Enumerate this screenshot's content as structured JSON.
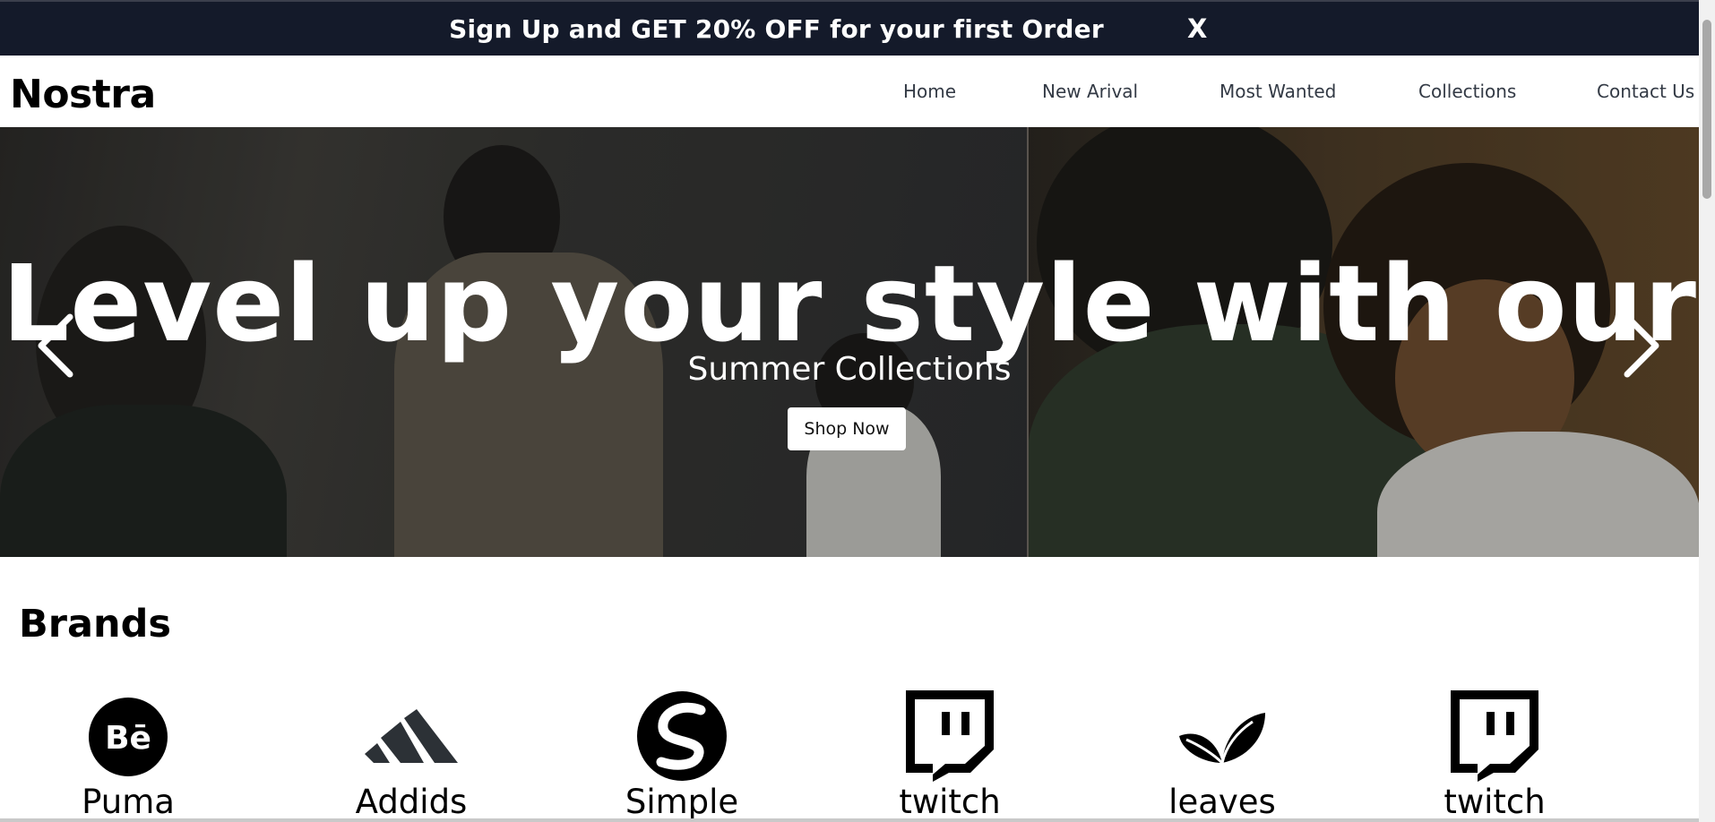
{
  "promo": {
    "text": "Sign Up and GET 20% OFF for your first Order",
    "close_label": "X"
  },
  "header": {
    "logo": "Nostra",
    "nav": [
      "Home",
      "New Arival",
      "Most Wanted",
      "Collections",
      "Contact Us"
    ]
  },
  "hero": {
    "title": "Level up your style with our",
    "subtitle": "Summer Collections",
    "button_label": "Shop Now",
    "prev_icon": "chevron-left-icon",
    "next_icon": "chevron-right-icon"
  },
  "brands": {
    "title": "Brands",
    "items": [
      {
        "label": "Puma",
        "icon": "behance-icon"
      },
      {
        "label": "Addids",
        "icon": "adidas-icon"
      },
      {
        "label": "Simple",
        "icon": "squarespace-s-icon"
      },
      {
        "label": "twitch",
        "icon": "twitch-icon"
      },
      {
        "label": "leaves",
        "icon": "leaves-icon"
      },
      {
        "label": "twitch",
        "icon": "twitch-icon"
      }
    ]
  }
}
